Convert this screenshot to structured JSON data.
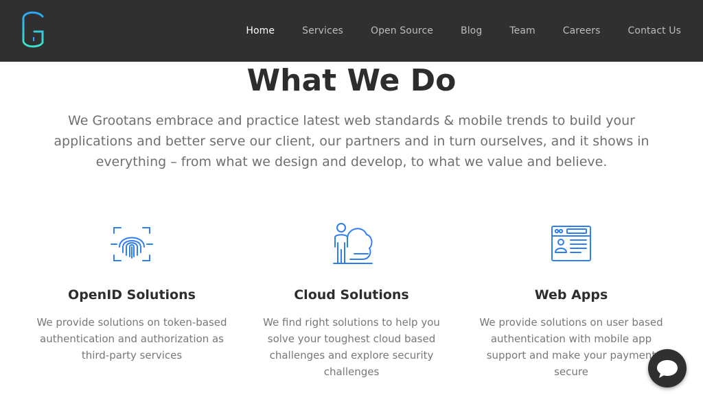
{
  "colors": {
    "navbar_bg": "#303030",
    "accent": "#2f7ef0",
    "logo_blue": "#2aa8f4",
    "logo_teal": "#3ee0c9"
  },
  "nav": {
    "items": [
      {
        "label": "Home",
        "active": true
      },
      {
        "label": "Services"
      },
      {
        "label": "Open Source"
      },
      {
        "label": "Blog"
      },
      {
        "label": "Team"
      },
      {
        "label": "Careers"
      },
      {
        "label": "Contact Us"
      }
    ]
  },
  "section": {
    "title": "What We Do",
    "intro": "We Grootans embrace and practice latest web standards & mobile trends to build your applications and better serve our client, our partners and in turn ourselves, and it shows in everything – from what we design and develop, to what we value and believe."
  },
  "cards": [
    {
      "title": "OpenID Solutions",
      "desc": "We provide solutions on token-based authentication and authorization as third-party services",
      "icon": "fingerprint-icon"
    },
    {
      "title": "Cloud Solutions",
      "desc": "We find right solutions to help you solve your toughest cloud based challenges and explore security challenges",
      "icon": "cloud-person-icon"
    },
    {
      "title": "Web Apps",
      "desc": "We provide solutions on user based authentication with mobile app support and make your payment secure",
      "icon": "web-profile-icon"
    }
  ],
  "chat": {
    "icon": "chat-bubble-icon"
  }
}
